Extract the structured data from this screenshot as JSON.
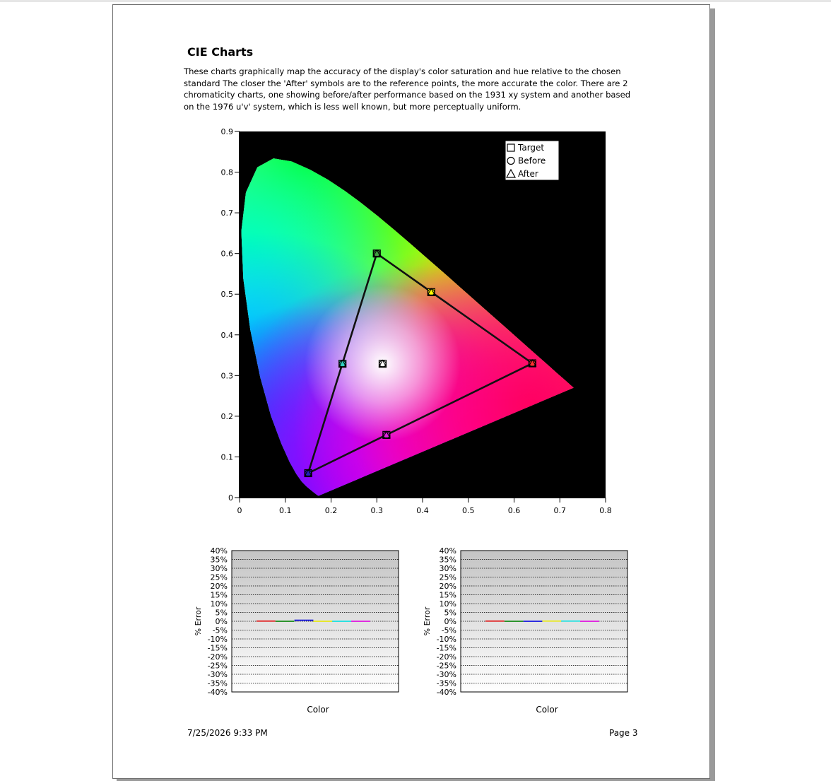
{
  "document": {
    "title": "CIE Charts",
    "description": "These charts graphically map the accuracy of the display's color saturation and hue relative to the chosen standard The closer the 'After' symbols are to the reference points, the more accurate the color. There are 2 chromaticity charts, one showing before/after performance based on the 1931 xy system and another based on the 1976 u'v' system, which is less well known, but more perceptually uniform."
  },
  "footer": {
    "date": "7/25/2026 9:33 PM",
    "page": "Page 3"
  },
  "chart_data": [
    {
      "type": "scatter",
      "xlim": [
        0,
        0.8
      ],
      "ylim": [
        0,
        0.9
      ],
      "x_ticks": [
        "0",
        "0.1",
        "0.2",
        "0.3",
        "0.4",
        "0.5",
        "0.6",
        "0.7",
        "0.8"
      ],
      "y_ticks": [
        "0",
        "0.1",
        "0.2",
        "0.3",
        "0.4",
        "0.5",
        "0.6",
        "0.7",
        "0.8",
        "0.9"
      ],
      "background": "#000000",
      "legend": {
        "placement": "top-right",
        "entries": [
          "Target",
          "Before",
          "After"
        ]
      },
      "gamut_triangle": [
        [
          0.64,
          0.33
        ],
        [
          0.3,
          0.6
        ],
        [
          0.15,
          0.06
        ]
      ],
      "series": [
        {
          "name": "Target",
          "marker": "square",
          "points": [
            {
              "label": "Red",
              "x": 0.64,
              "y": 0.33,
              "color": "#ff3030"
            },
            {
              "label": "Yellow",
              "x": 0.419,
              "y": 0.505,
              "color": "#ffff00"
            },
            {
              "label": "Green",
              "x": 0.3,
              "y": 0.6,
              "color": "#40a040"
            },
            {
              "label": "Cyan",
              "x": 0.225,
              "y": 0.329,
              "color": "#30d0c0"
            },
            {
              "label": "Blue",
              "x": 0.15,
              "y": 0.06,
              "color": "#2020c0"
            },
            {
              "label": "Magenta",
              "x": 0.321,
              "y": 0.154,
              "color": "#e020e0"
            },
            {
              "label": "White",
              "x": 0.3127,
              "y": 0.329,
              "color": "#ffffff"
            }
          ]
        },
        {
          "name": "Before",
          "marker": "circle",
          "points": [
            {
              "label": "Red",
              "x": 0.64,
              "y": 0.33,
              "color": "#ff3030"
            },
            {
              "label": "Yellow",
              "x": 0.419,
              "y": 0.505,
              "color": "#ffff00"
            },
            {
              "label": "Green",
              "x": 0.3,
              "y": 0.6,
              "color": "#40a040"
            },
            {
              "label": "Cyan",
              "x": 0.225,
              "y": 0.329,
              "color": "#30d0c0"
            },
            {
              "label": "Blue",
              "x": 0.15,
              "y": 0.06,
              "color": "#2020c0"
            },
            {
              "label": "Magenta",
              "x": 0.321,
              "y": 0.154,
              "color": "#e020e0"
            },
            {
              "label": "White",
              "x": 0.3127,
              "y": 0.329,
              "color": "#ffffff"
            }
          ]
        },
        {
          "name": "After",
          "marker": "triangle",
          "points": [
            {
              "label": "Red",
              "x": 0.64,
              "y": 0.33,
              "color": "#ff3030"
            },
            {
              "label": "Yellow",
              "x": 0.419,
              "y": 0.505,
              "color": "#ffff00"
            },
            {
              "label": "Green",
              "x": 0.3,
              "y": 0.6,
              "color": "#40a040"
            },
            {
              "label": "Cyan",
              "x": 0.225,
              "y": 0.329,
              "color": "#30d0c0"
            },
            {
              "label": "Blue",
              "x": 0.15,
              "y": 0.06,
              "color": "#2020c0"
            },
            {
              "label": "Magenta",
              "x": 0.321,
              "y": 0.154,
              "color": "#e020e0"
            },
            {
              "label": "White",
              "x": 0.3127,
              "y": 0.329,
              "color": "#ffffff"
            }
          ]
        }
      ]
    },
    {
      "type": "bar",
      "xlabel": "Color",
      "ylabel": "% Error",
      "ylim": [
        -40,
        40
      ],
      "y_ticks": [
        "40%",
        "35%",
        "30%",
        "25%",
        "20%",
        "15%",
        "10%",
        "5%",
        "0%",
        "-5%",
        "-10%",
        "-15%",
        "-20%",
        "-25%",
        "-30%",
        "-35%",
        "-40%"
      ],
      "categories": [
        "Red",
        "Green",
        "Blue",
        "Yellow",
        "Cyan",
        "Magenta"
      ],
      "colors": [
        "#e00000",
        "#008000",
        "#0000e0",
        "#e8e800",
        "#00e0e0",
        "#e000e0"
      ],
      "values": [
        0.1,
        -0.1,
        0.6,
        -0.1,
        0.0,
        -0.1
      ]
    },
    {
      "type": "bar",
      "xlabel": "Color",
      "ylabel": "% Error",
      "ylim": [
        -40,
        40
      ],
      "y_ticks": [
        "40%",
        "35%",
        "30%",
        "25%",
        "20%",
        "15%",
        "10%",
        "5%",
        "0%",
        "-5%",
        "-10%",
        "-15%",
        "-20%",
        "-25%",
        "-30%",
        "-35%",
        "-40%"
      ],
      "categories": [
        "Red",
        "Green",
        "Blue",
        "Yellow",
        "Cyan",
        "Magenta"
      ],
      "colors": [
        "#e00000",
        "#008000",
        "#0000e0",
        "#e8e800",
        "#00e0e0",
        "#e000e0"
      ],
      "values": [
        0.1,
        -0.1,
        -0.6,
        0.1,
        0.1,
        -0.4
      ]
    }
  ]
}
